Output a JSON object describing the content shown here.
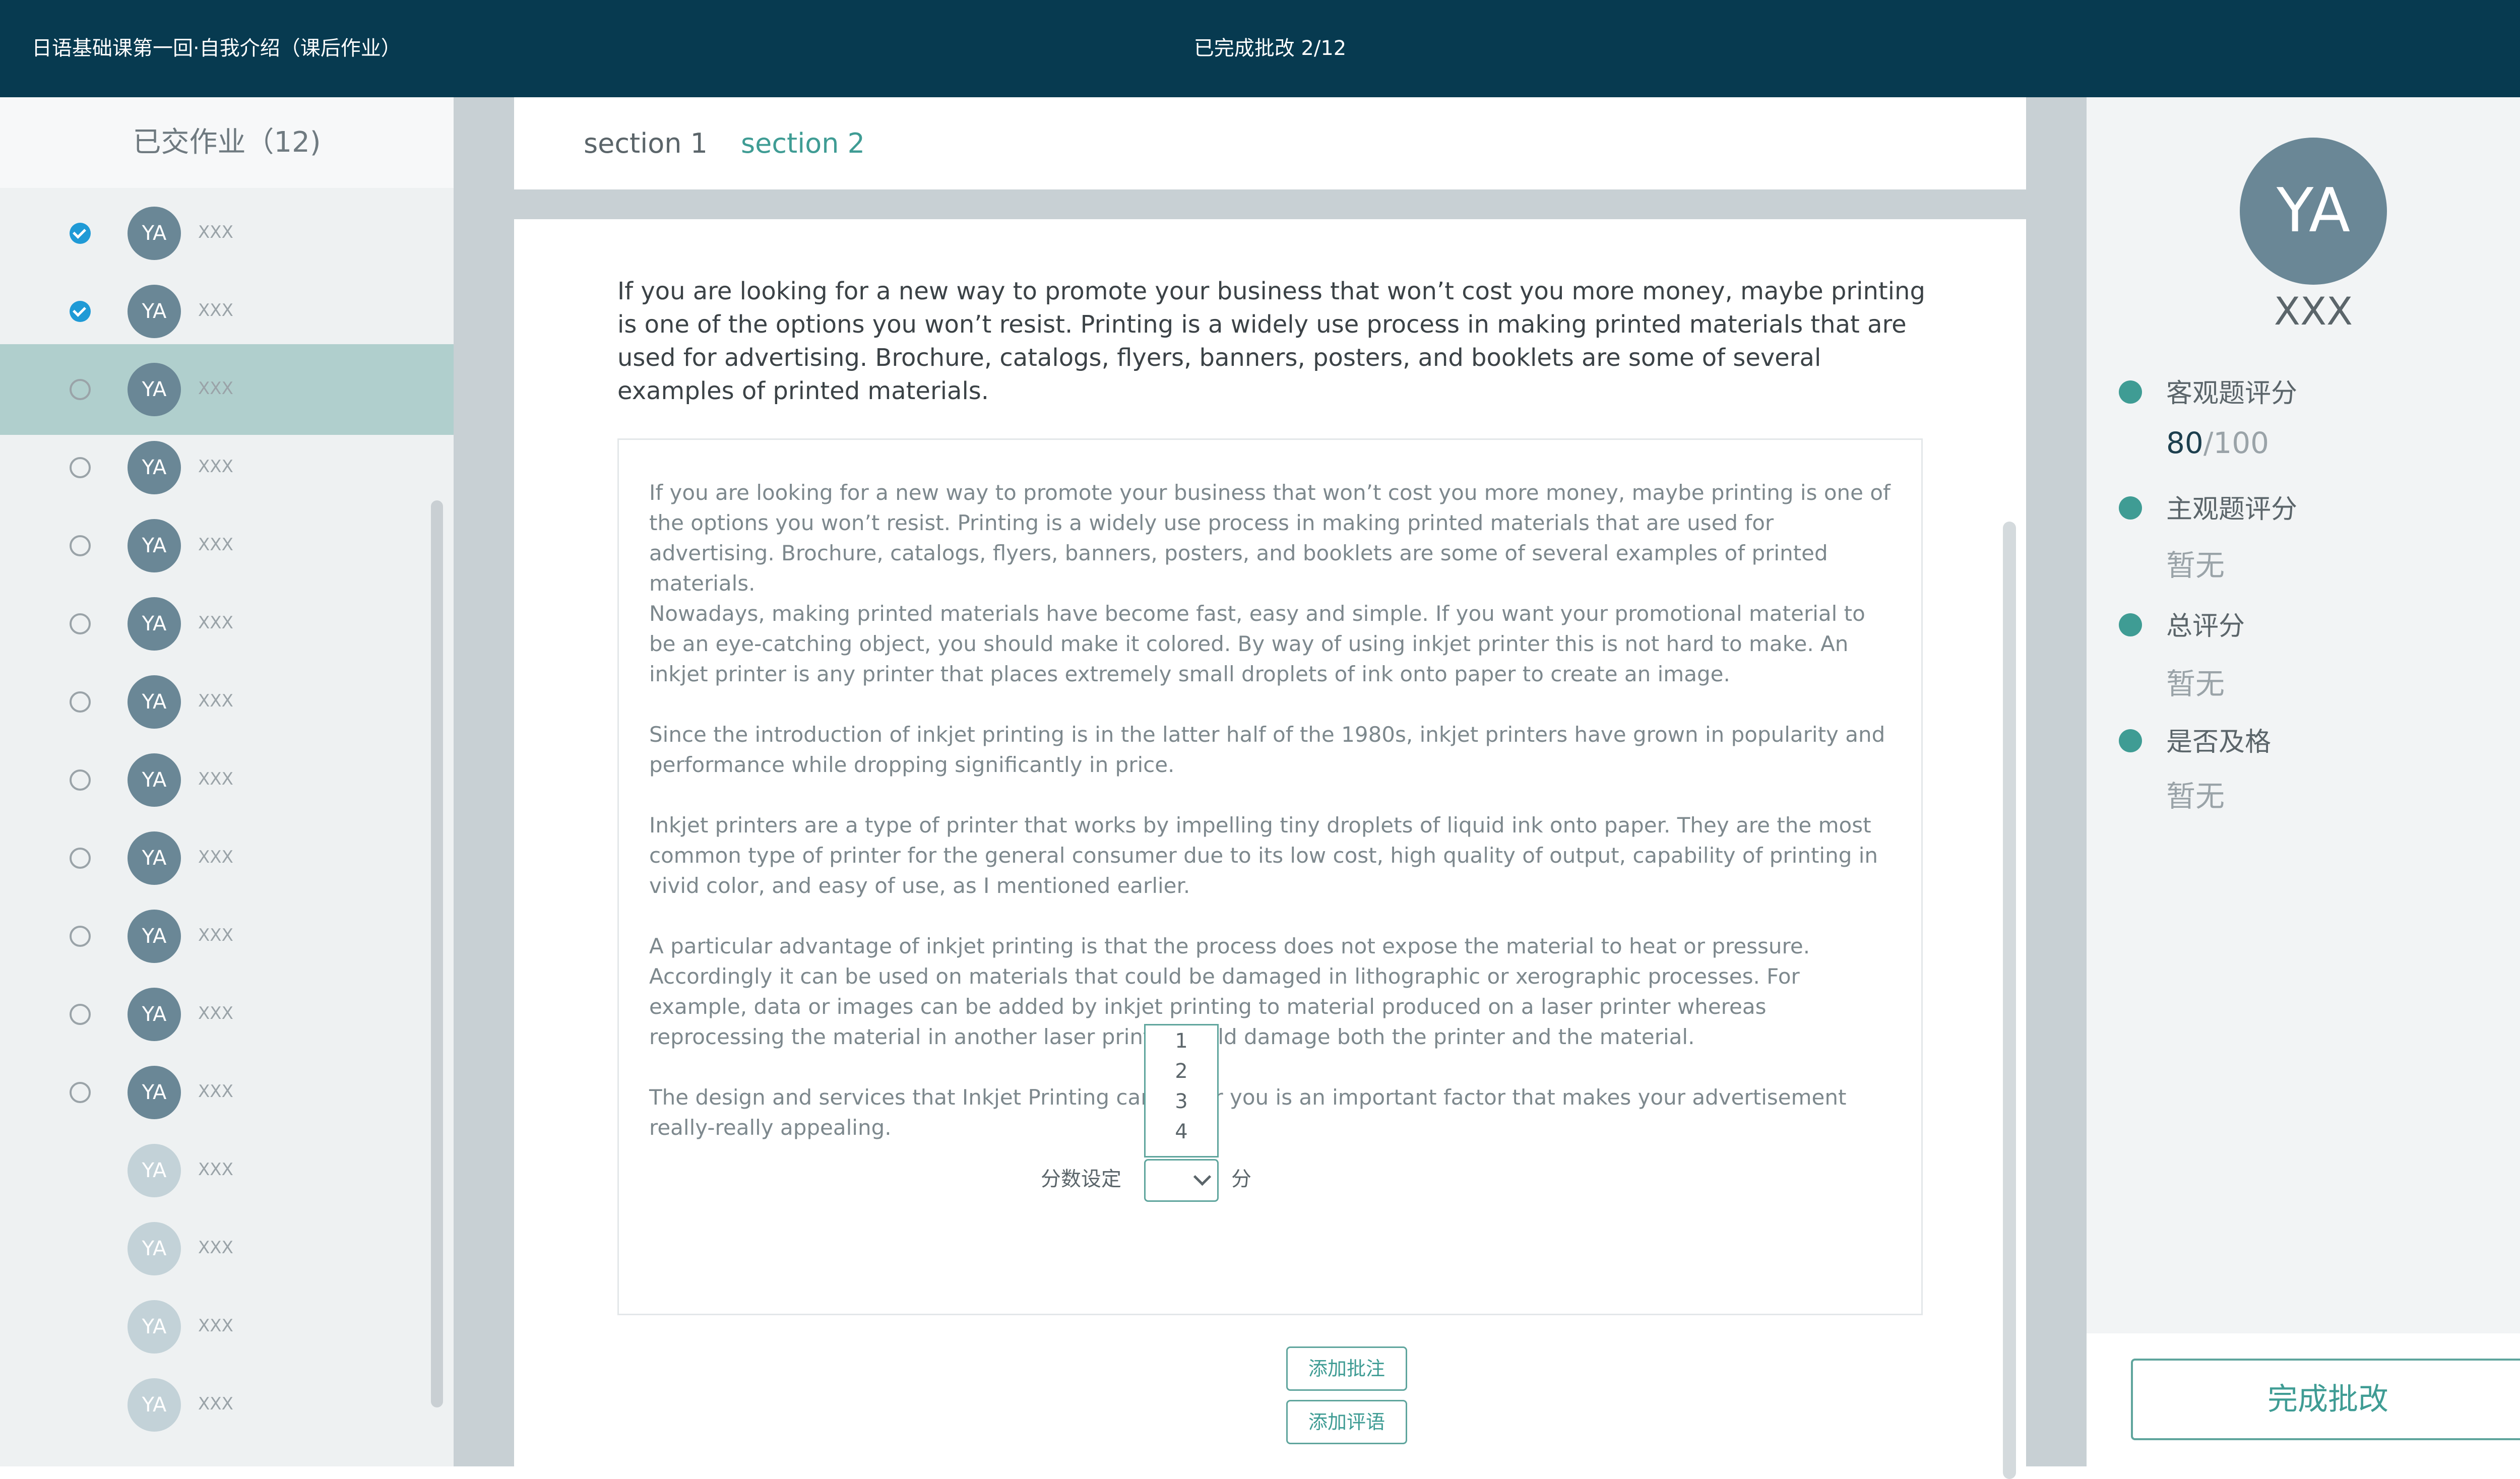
{
  "topbar": {
    "title": "日语基础课第一回·自我介绍（课后作业）",
    "progress": "已完成批改 2/12"
  },
  "sidebar": {
    "header": "已交作业（12)",
    "students": [
      {
        "avatar": "YA",
        "name": "XXX",
        "status": "checked"
      },
      {
        "avatar": "YA",
        "name": "XXX",
        "status": "checked"
      },
      {
        "avatar": "YA",
        "name": "XXX",
        "status": "unchecked",
        "selected": true
      },
      {
        "avatar": "YA",
        "name": "XXX",
        "status": "unchecked"
      },
      {
        "avatar": "YA",
        "name": "XXX",
        "status": "unchecked"
      },
      {
        "avatar": "YA",
        "name": "XXX",
        "status": "unchecked"
      },
      {
        "avatar": "YA",
        "name": "XXX",
        "status": "unchecked"
      },
      {
        "avatar": "YA",
        "name": "XXX",
        "status": "unchecked"
      },
      {
        "avatar": "YA",
        "name": "XXX",
        "status": "unchecked"
      },
      {
        "avatar": "YA",
        "name": "XXX",
        "status": "unchecked"
      },
      {
        "avatar": "YA",
        "name": "XXX",
        "status": "unchecked"
      },
      {
        "avatar": "YA",
        "name": "XXX",
        "status": "unchecked"
      },
      {
        "avatar": "YA",
        "name": "XXX",
        "status": "none"
      },
      {
        "avatar": "YA",
        "name": "XXX",
        "status": "none"
      },
      {
        "avatar": "YA",
        "name": "XXX",
        "status": "none"
      },
      {
        "avatar": "YA",
        "name": "XXX",
        "status": "none"
      }
    ]
  },
  "tabs": [
    "section 1",
    "section 2"
  ],
  "active_tab": "section 2",
  "prompt": "If you are looking for a new way to promote your business that won’t cost you more money, maybe printing is one of the options you won’t resist. Printing is a widely use process in making printed materials that are used for advertising. Brochure, catalogs, flyers, banners, posters, and booklets are some of several examples of printed materials.",
  "answer": [
    "If you are looking for a new way to promote your business that won’t cost you more money, maybe printing is one of the options you won’t resist. Printing is a widely use process in making printed materials that are used for advertising. Brochure, catalogs, flyers, banners, posters, and booklets are some of several examples of printed materials.",
    "Nowadays, making printed materials have become fast, easy and simple. If you want your promotional material to be an eye-catching object, you should make it colored. By way of using inkjet printer this is not hard to make. An inkjet printer is any printer that places extremely small droplets of ink onto paper to create an image.",
    "Since the introduction of inkjet printing is in the latter half of the 1980s, inkjet printers have grown in popularity and performance while dropping significantly in price.",
    "Inkjet printers are a type of printer that works by impelling tiny droplets of liquid ink onto paper. They are the most common type of printer for the general consumer due to its low cost, high quality of output, capability of printing in vivid color, and easy of use, as I mentioned earlier.",
    "A particular advantage of inkjet printing is that the process does not expose the material to heat or pressure. Accordingly it can be used on materials that could be damaged in lithographic or xerographic processes. For example, data or images can be added by inkjet printing to material produced on a laser printer whereas reprocessing the material in another laser printer could damage both the printer and the material.",
    "The design and services that Inkjet Printing can do for you is an important factor that makes your advertisement really-really appealing."
  ],
  "scoring": {
    "label": "分数设定",
    "options": [
      "1",
      "2",
      "3",
      "4"
    ],
    "selected": "",
    "unit": "分",
    "add_annotation": "添加批注",
    "add_comment": "添加评语"
  },
  "student_panel": {
    "avatar": "YA",
    "name": "XXX",
    "objective_label": "客观题评分",
    "objective_score": "80",
    "objective_total": "/100",
    "subjective_label": "主观题评分",
    "subjective_value": "暂无",
    "total_label": "总评分",
    "total_value": "暂无",
    "pass_label": "是否及格",
    "pass_value": "暂无",
    "finish_button": "完成批改"
  },
  "colors": {
    "topbar": "#073a50",
    "accent": "#3f9c94",
    "checkbox": "#1f9ad6",
    "avatar": "#6a8796",
    "selected_row": "#b0cfcd"
  }
}
